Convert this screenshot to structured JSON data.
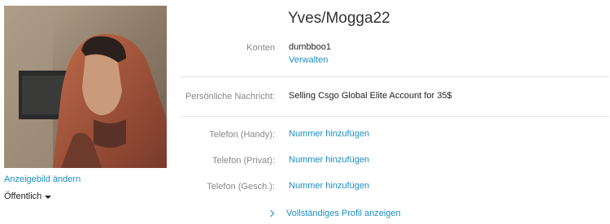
{
  "profile": {
    "display_name": "Yves/Mogga22",
    "change_picture_label": "Anzeigebild ändern",
    "visibility_label": "Öffentlich"
  },
  "fields": {
    "accounts_label": "Konten",
    "accounts_value": "dumbboo1",
    "manage_label": "Verwalten",
    "message_label": "Persönliche Nachricht:",
    "message_value": "Selling Csgo Global Elite Account for 35$",
    "phone_mobile_label": "Telefon (Handy):",
    "phone_mobile_value": "Nummer hinzufügen",
    "phone_home_label": "Telefon (Privat):",
    "phone_home_value": "Nummer hinzufügen",
    "phone_work_label": "Telefon (Gesch.):",
    "phone_work_value": "Nummer hinzufügen"
  },
  "footer": {
    "full_profile_label": "Vollständiges Profil anzeigen"
  },
  "colors": {
    "link": "#1b8ec8",
    "label": "#888888",
    "divider": "#e4e4e4"
  }
}
